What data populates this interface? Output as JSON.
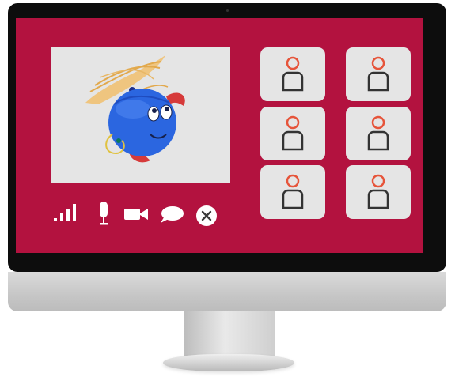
{
  "app": {
    "screen_color": "#b3123f",
    "tile_color": "#e5e5e5",
    "avatar_head_color": "#e6543a",
    "avatar_body_color": "#333333"
  },
  "main_video": {
    "participant_icon": "blue-ball-character-with-propeller"
  },
  "participants": [
    {
      "icon": "person-icon"
    },
    {
      "icon": "person-icon"
    },
    {
      "icon": "person-icon"
    },
    {
      "icon": "person-icon"
    },
    {
      "icon": "person-icon"
    },
    {
      "icon": "person-icon"
    }
  ],
  "controls": [
    {
      "icon": "signal-strength-icon"
    },
    {
      "icon": "microphone-icon"
    },
    {
      "icon": "video-camera-icon"
    },
    {
      "icon": "chat-bubble-icon"
    },
    {
      "icon": "end-call-icon"
    }
  ]
}
